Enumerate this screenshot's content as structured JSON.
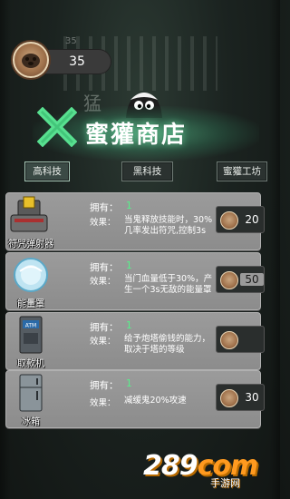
{
  "header": {
    "coin_count": "35",
    "faded_count": "35",
    "watermark_text": "猛",
    "shop_title": "蜜獾商店"
  },
  "tabs": [
    {
      "label": "高科技",
      "active": true
    },
    {
      "label": "黑科技",
      "active": false
    },
    {
      "label": "蜜獾工坊",
      "active": false
    }
  ],
  "items": [
    {
      "name": "符咒弹射器",
      "own_label": "拥有：",
      "own_value": "1",
      "effect_label": "效果：",
      "effect_text": "当鬼释放技能时，30%几率发出符咒,控制3s",
      "price": "20",
      "icon": "talisman-launcher-icon"
    },
    {
      "name": "能量罩",
      "own_label": "拥有：",
      "own_value": "1",
      "effect_label": "效果：",
      "effect_text": "当门血量低于30%，产生一个3s无敌的能量罩",
      "price": "50",
      "icon": "energy-shield-icon"
    },
    {
      "name": "取款机",
      "own_label": "拥有：",
      "own_value": "1",
      "effect_label": "效果：",
      "effect_text": "给予炮塔偷钱的能力，取决于塔的等级",
      "price": "",
      "icon": "atm-icon"
    },
    {
      "name": "冰箱",
      "own_label": "拥有：",
      "own_value": "1",
      "effect_label": "效果：",
      "effect_text": "减缓鬼20%攻速",
      "price": "30",
      "icon": "fridge-icon"
    }
  ],
  "atm_label": "ATM",
  "watermark": {
    "logo_a": "289",
    "logo_b": "com",
    "sub": "手游网"
  },
  "colors": {
    "accent_green": "#57f08a",
    "title_glow": "#5ad296",
    "panel_gray": "#9b9b9b"
  }
}
